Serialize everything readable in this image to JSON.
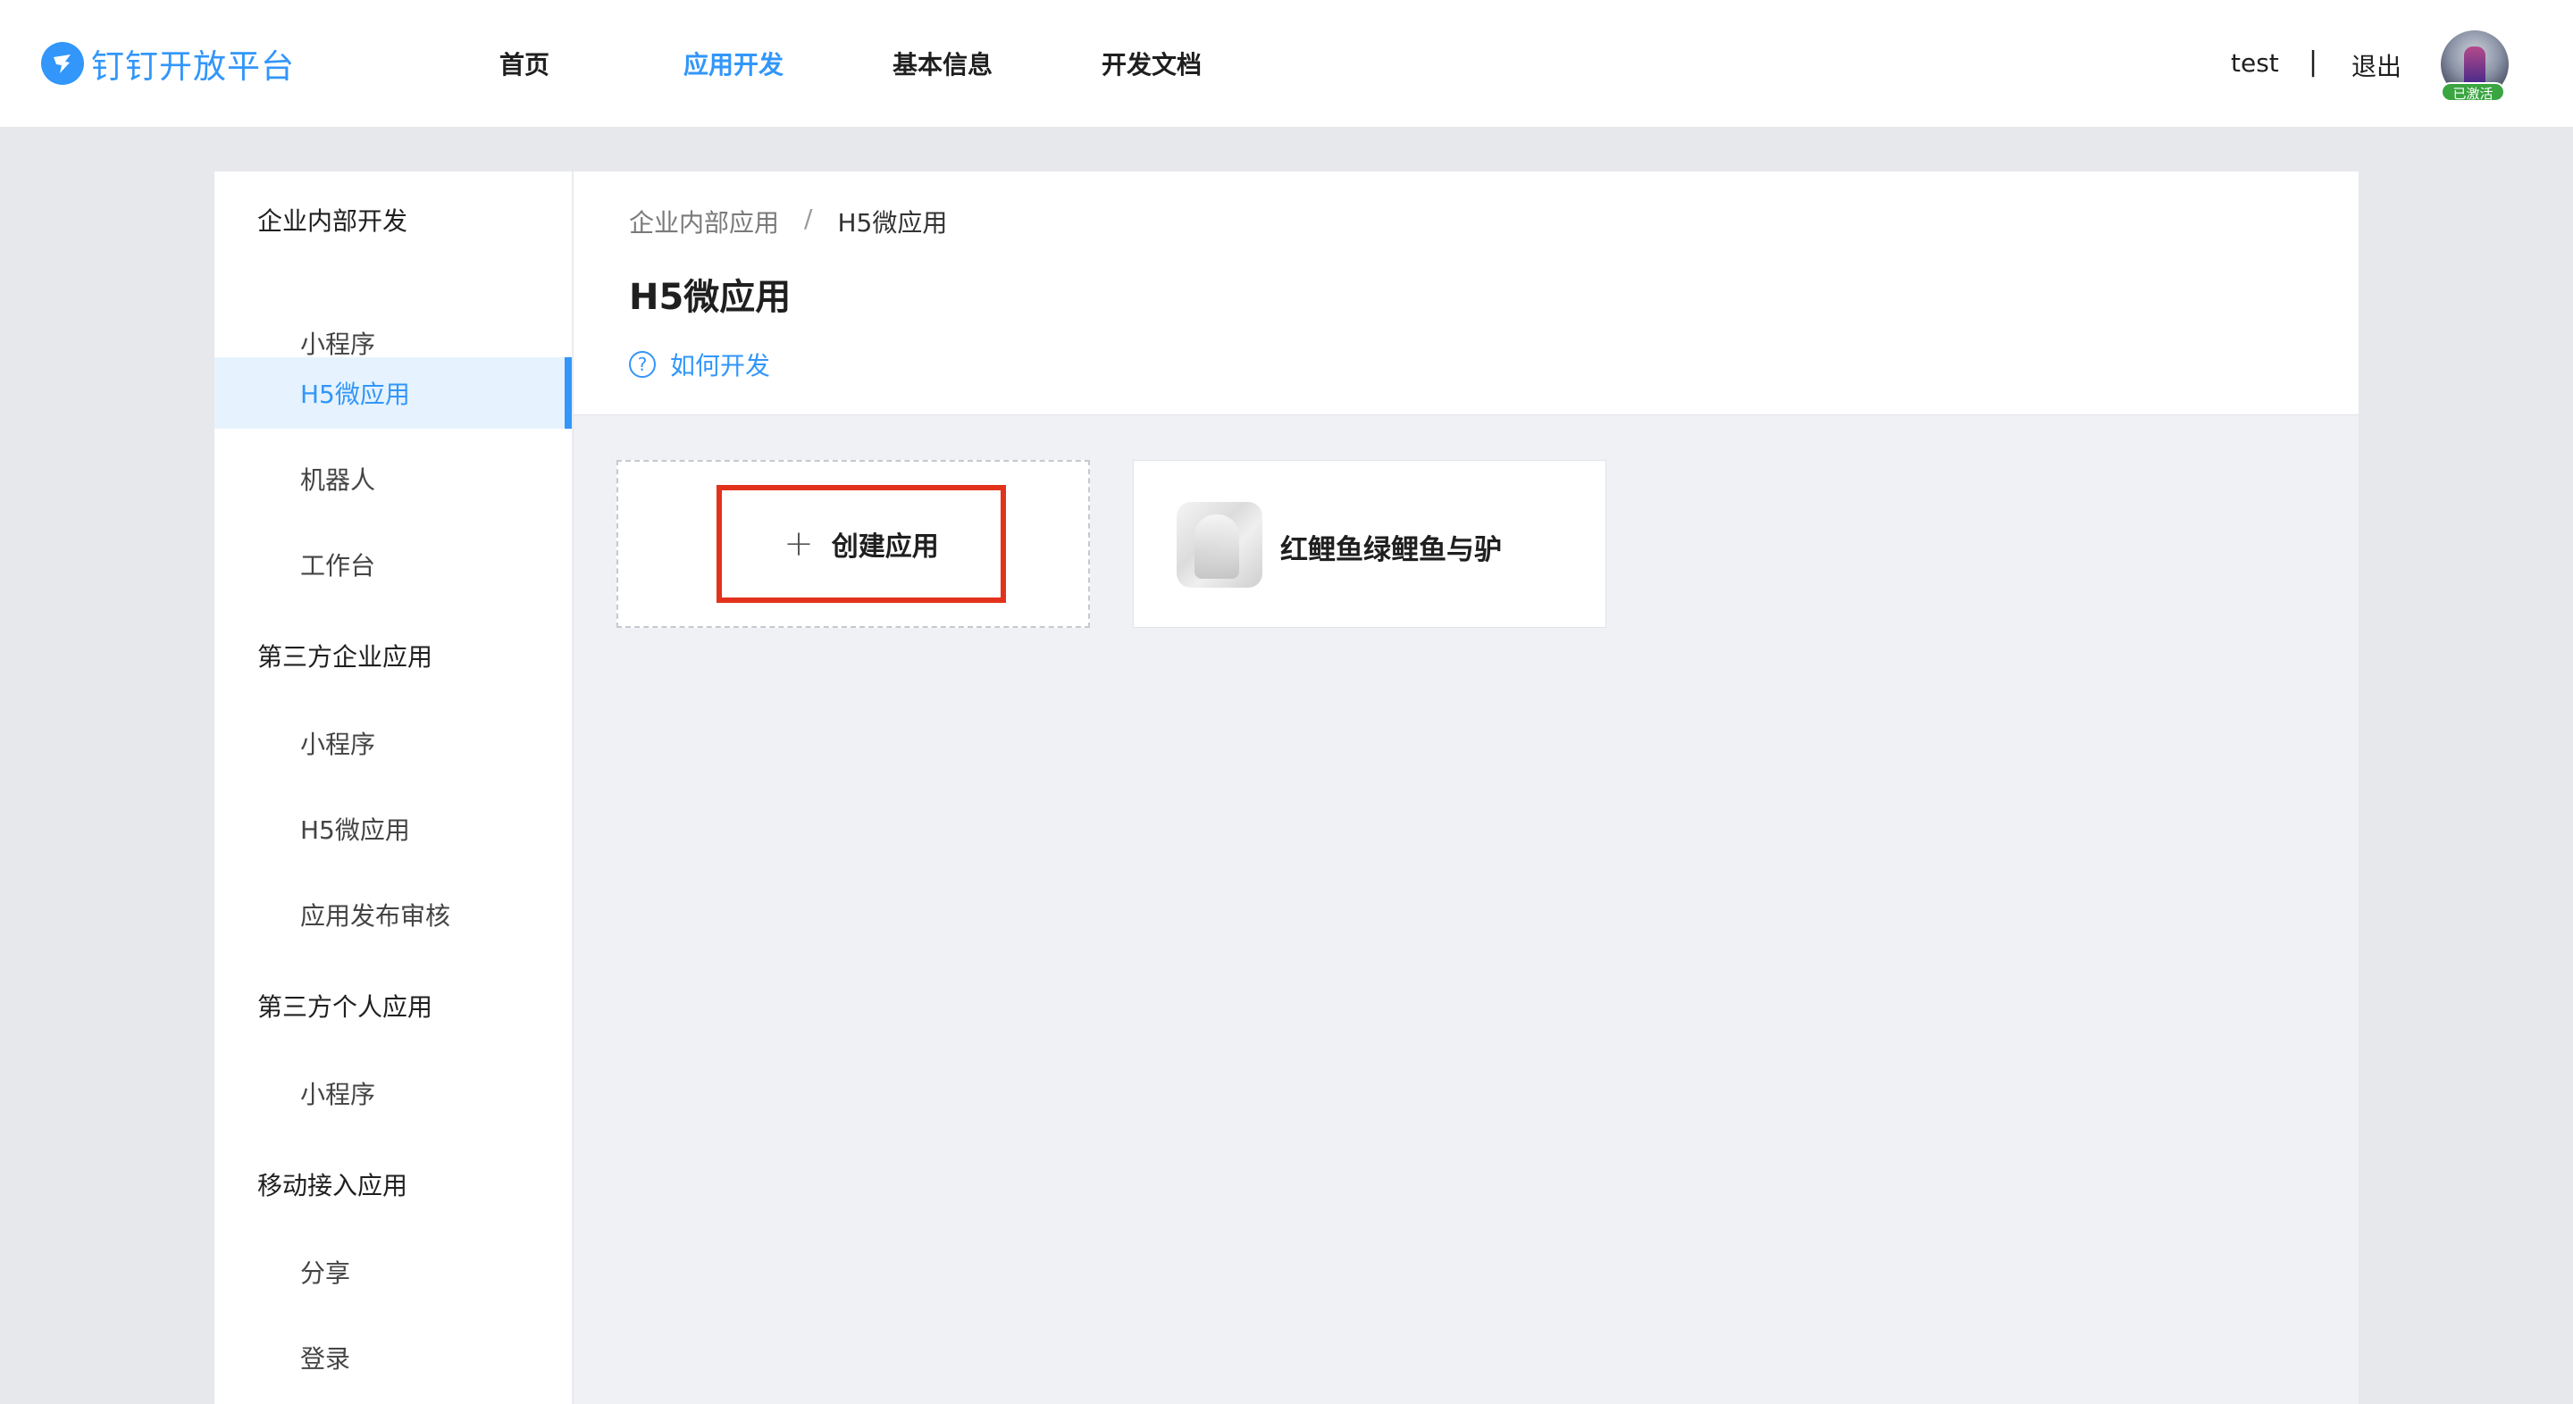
{
  "header": {
    "logo_text": "钉钉开放平台",
    "nav": [
      "首页",
      "应用开发",
      "基本信息",
      "开发文档"
    ],
    "active_nav_index": 1,
    "username": "test",
    "separator": "|",
    "logout": "退出",
    "avatar_badge": "已激活",
    "accent_color": "#3296fa",
    "badge_color": "#3aa541"
  },
  "sidebar": {
    "groups": [
      {
        "title": "企业内部开发",
        "items": [
          "小程序",
          "H5微应用",
          "机器人",
          "工作台"
        ]
      },
      {
        "title": "第三方企业应用",
        "items": [
          "小程序",
          "H5微应用",
          "应用发布审核"
        ]
      },
      {
        "title": "第三方个人应用",
        "items": [
          "小程序"
        ]
      },
      {
        "title": "移动接入应用",
        "items": [
          "分享",
          "登录"
        ]
      }
    ],
    "active": "企业内部开发 / H5微应用"
  },
  "main": {
    "breadcrumb": [
      "企业内部应用",
      "/",
      "H5微应用"
    ],
    "title": "H5微应用",
    "help_link": "如何开发",
    "create_label": "创建应用",
    "plus_symbol": "+",
    "apps": [
      {
        "name": "红鲤鱼绿鲤鱼与驴"
      }
    ],
    "highlight_color": "#e3321c"
  }
}
